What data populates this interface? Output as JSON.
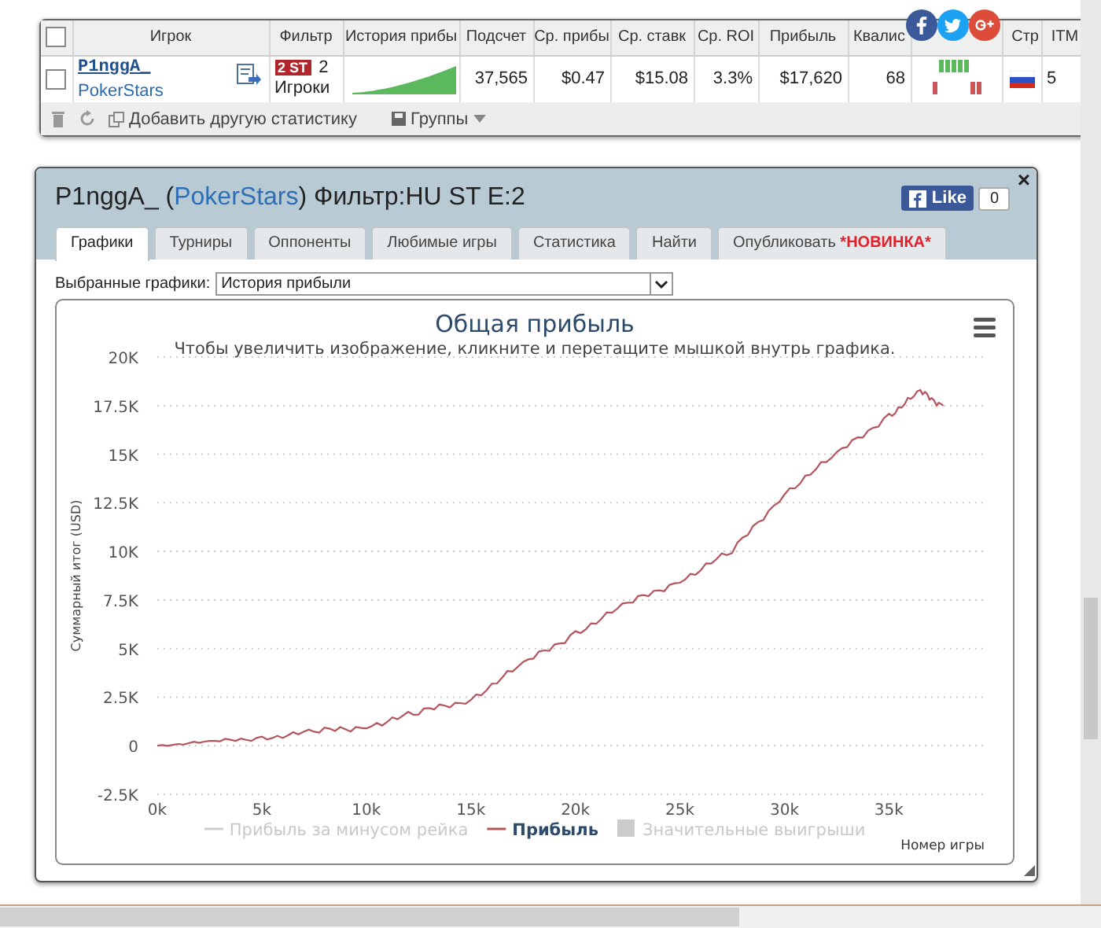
{
  "stats_table": {
    "select_all_checked": false,
    "columns": [
      {
        "kind": "checkbox"
      },
      {
        "label": "Игрок"
      },
      {
        "label": "Фильтр"
      },
      {
        "label": "История прибы"
      },
      {
        "label": "Подсчет"
      },
      {
        "label": "Ср. прибы"
      },
      {
        "label": "Ср. ставк"
      },
      {
        "label": "Ср. ROI"
      },
      {
        "label": "Прибыль"
      },
      {
        "label": "Квалис"
      },
      {
        "kind": "covered"
      },
      {
        "label": "Стр"
      },
      {
        "label": "ITM"
      }
    ],
    "rows": [
      {
        "checked": false,
        "player": "P1nggA_",
        "site": "PokerStars",
        "filter_badge": "2 ST",
        "filter_count": "2",
        "filter_label": "Игроки",
        "count": "37,565",
        "avg_profit": "$0.47",
        "avg_stake": "$15.08",
        "roi": "3.3%",
        "profit": "$17,620",
        "qualis": "68",
        "form": [
          {
            "kind": "loss"
          },
          {
            "kind": "win"
          },
          {
            "kind": "win"
          },
          {
            "kind": "win"
          },
          {
            "kind": "win"
          },
          {
            "kind": "win"
          },
          {
            "kind": "loss"
          },
          {
            "kind": "loss"
          }
        ],
        "itm": "5"
      }
    ],
    "toolbar": {
      "add_stat": "Добавить другую статистику",
      "groups": "Группы"
    }
  },
  "panel": {
    "title_player": "P1nggA_ (",
    "title_site": "PokerStars",
    "title_filter": ") Фильтр:HU ST E:2",
    "like_label": "Like",
    "like_count": "0",
    "close": "×",
    "tabs": [
      {
        "label": "Графики",
        "selected": true
      },
      {
        "label": "Турниры",
        "selected": false
      },
      {
        "label": "Оппоненты",
        "selected": false
      },
      {
        "label": "Любимые игры",
        "selected": false
      },
      {
        "label": "Статистика",
        "selected": false
      },
      {
        "label": "Найти",
        "selected": false
      },
      {
        "label": "Опубликовать",
        "badge": "*НОВИНКА*",
        "selected": false
      }
    ],
    "chart_select": {
      "label": "Выбранные графики:",
      "value": "История прибыли"
    },
    "chart": {
      "subtitle": "Чтобы увеличить изображение, кликните и перетащите мышкой внутрь графика.",
      "legend": [
        {
          "label": "Прибыль за минусом рейка",
          "kind": "line",
          "hidden": true
        },
        {
          "kind": "line",
          "hidden": false
        },
        {
          "label": "Значительные выигрыши",
          "kind": "area",
          "hidden": true
        }
      ],
      "chart_data": {
        "type": "line",
        "title": "Общая прибыль",
        "xlabel": "Номер игры",
        "ylabel": "Суммарный итог (USD)",
        "x": [
          0,
          2.5,
          5,
          7.5,
          10,
          12.5,
          15,
          17.5,
          20,
          22.5,
          25,
          27.5,
          30,
          32.5,
          35,
          36.5,
          37.6
        ],
        "series": [
          {
            "name": "Прибыль",
            "color": "#b5545c",
            "values": [
              0,
              0.2,
              0.4,
              0.7,
              1.0,
              1.7,
              2.4,
              4.2,
              5.8,
              7.3,
              8.5,
              10,
              13,
              15,
              17,
              18.2,
              17.5
            ]
          }
        ],
        "xlim": [
          0,
          39.5
        ],
        "ylim": [
          -2.5,
          20
        ],
        "grid": true,
        "xticks": [
          {
            "value": 0,
            "label": "0k"
          },
          {
            "value": 5,
            "label": "5k"
          },
          {
            "value": 10,
            "label": "10k"
          },
          {
            "value": 15,
            "label": "15k"
          },
          {
            "value": 20,
            "label": "20k"
          },
          {
            "value": 25,
            "label": "25k"
          },
          {
            "value": 30,
            "label": "30k"
          },
          {
            "value": 35,
            "label": "35k"
          }
        ],
        "yticks": [
          {
            "value": -2.5,
            "label": "-2.5K"
          },
          {
            "value": 0,
            "label": "0"
          },
          {
            "value": 2.5,
            "label": "2.5K"
          },
          {
            "value": 5,
            "label": "5K"
          },
          {
            "value": 7.5,
            "label": "7.5K"
          },
          {
            "value": 10,
            "label": "10K"
          },
          {
            "value": 12.5,
            "label": "12.5K"
          },
          {
            "value": 15,
            "label": "15K"
          },
          {
            "value": 17.5,
            "label": "17.5K"
          },
          {
            "value": 20,
            "label": "20K"
          }
        ]
      }
    }
  }
}
